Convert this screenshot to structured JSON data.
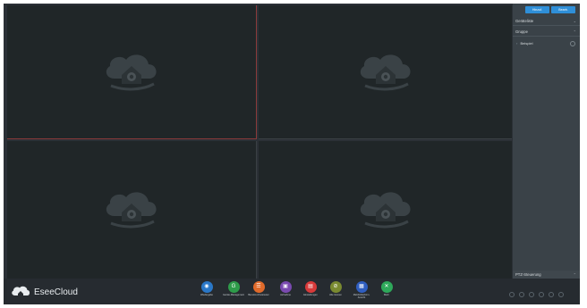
{
  "panel": {
    "top_buttons": [
      "Hinzuf.",
      "Bearb."
    ],
    "sections": [
      "Geräteliste",
      "Gruppe"
    ],
    "tree_item": "Beispiel",
    "ptz": "PTZ-Steuerung"
  },
  "bottom": {
    "brand": "EseeCloud",
    "tools": [
      {
        "label": "Wiedergabe",
        "color": "#2a78c8",
        "icon": "playback-icon"
      },
      {
        "label": "Geräte-Management",
        "color": "#2e9b4a",
        "icon": "device-management-icon"
      },
      {
        "label": "Benutzer-Parameter",
        "color": "#e06a2a",
        "icon": "user-params-icon"
      },
      {
        "label": "Aufnahme",
        "color": "#7a4ab0",
        "icon": "record-icon"
      },
      {
        "label": "Einstellungen",
        "color": "#d83a3a",
        "icon": "settings-icon"
      },
      {
        "label": "Alle trennen",
        "color": "#7a8a30",
        "icon": "disconnect-icon"
      },
      {
        "label": "Mehrbildschirm-Ansicht",
        "color": "#2f5ec0",
        "icon": "multiview-icon"
      },
      {
        "label": "Mehr",
        "color": "#2ea85a",
        "icon": "more-icon"
      }
    ]
  }
}
